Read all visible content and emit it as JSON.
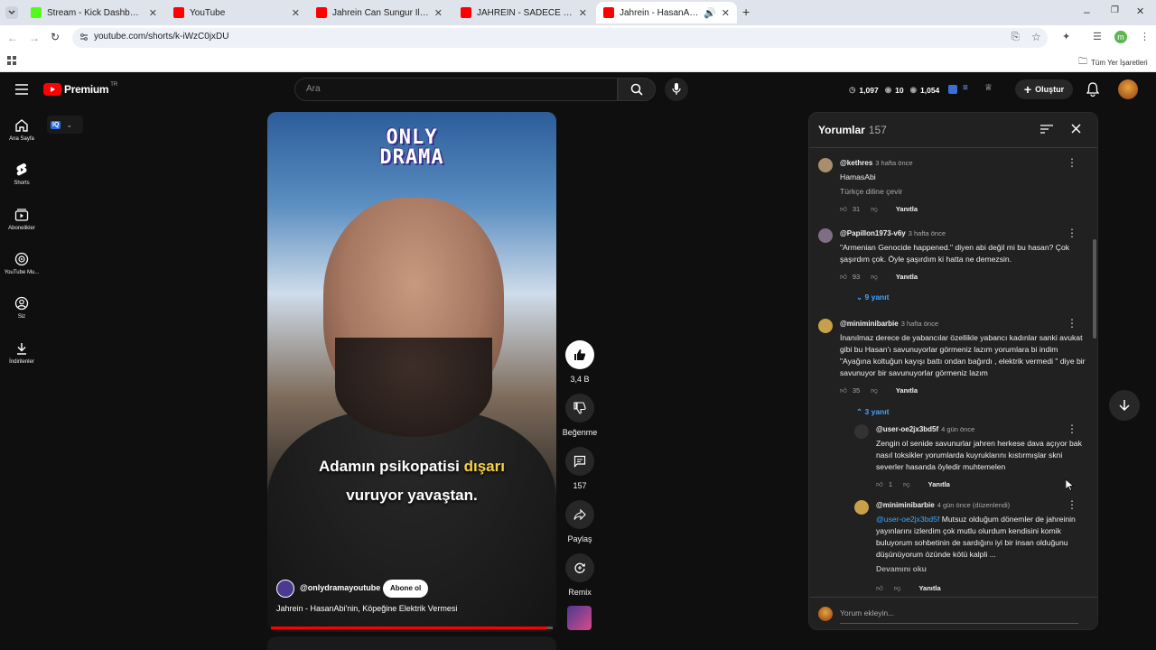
{
  "browser": {
    "tabs": [
      {
        "title": "Stream - Kick Dashboard",
        "color": "#53fc18"
      },
      {
        "title": "YouTube",
        "color": "#ff0000"
      },
      {
        "title": "Jahrein Can Sungur İle Geçmişt",
        "color": "#ff0000"
      },
      {
        "title": "JAHREİN - SADECE ENES \"JAHR",
        "color": "#ff0000"
      },
      {
        "title": "Jahrein - HasanAbi'nin, Köp",
        "color": "#ff0000"
      }
    ],
    "url": "youtube.com/shorts/k-iWzC0jxDU",
    "bookmarks_label": "Tüm Yer İşaretleri",
    "profile_letter": "m"
  },
  "header": {
    "brand": "Premium",
    "brand_sup": "TR",
    "search_placeholder": "Ara",
    "stats": [
      "1,097",
      "10",
      "1,054"
    ],
    "create_label": "Oluştur"
  },
  "sidebar": {
    "items": [
      {
        "label": "Ana Sayfa",
        "icon": "home-icon"
      },
      {
        "label": "Shorts",
        "icon": "shorts-icon"
      },
      {
        "label": "Abonelikler",
        "icon": "subscriptions-icon"
      },
      {
        "label": "YouTube Mu...",
        "icon": "music-icon"
      },
      {
        "label": "Siz",
        "icon": "you-icon"
      },
      {
        "label": "İndirilenler",
        "icon": "download-icon"
      }
    ],
    "extension_badge": "IQ"
  },
  "video": {
    "logo_line1": "ONLY",
    "logo_line2": "DRAMA",
    "caption_line1_a": "Adamın psikopatisi ",
    "caption_line1_b": "dışarı",
    "caption_line2": "vuruyor yavaştan.",
    "channel": "@onlydramayoutube",
    "subscribe": "Abone ol",
    "title": "Jahrein - HasanAbi'nin, Köpeğine Elektrik Vermesi",
    "progress": 0.98
  },
  "actions": {
    "likes": "3,4 B",
    "dislike": "Beğenme",
    "comments": "157",
    "share": "Paylaş",
    "remix": "Remix"
  },
  "comments": {
    "title": "Yorumlar",
    "count": "157",
    "add_placeholder": "Yorum ekleyin...",
    "reply_label": "Yanıtla",
    "list": [
      {
        "handle": "@kethres",
        "time": "3 hafta önce",
        "text": "HamasAbi",
        "translate": "Türkçe diline çevir",
        "likes": "31"
      },
      {
        "handle": "@Papillon1973-v6y",
        "time": "3 hafta önce",
        "text": "\"Armenian Genocide happened.\" diyen abi değil mi bu hasan? Çok şaşırdım çok. Öyle şaşırdım ki hatta ne demezsin.",
        "likes": "93",
        "replies": "9 yanıt"
      },
      {
        "handle": "@miniminibarbie",
        "time": "3 hafta önce",
        "text": "İnanılmaz derece de yabancılar özellikle yabancı kadınlar sanki avukat gibi bu Hasan'ı savunuyorlar görmeniz lazım yorumlara bi indim \"Ayağına koltuğun kayışı battı ondan bağırdı , elektrik vermedi \" diye bir savunuyor bir savunuyorlar görmeniz lazım",
        "likes": "35",
        "replies": "3 yanıt"
      }
    ],
    "replies": [
      {
        "handle": "@user-oe2jx3bd5f",
        "time": "4 gün önce",
        "text": "Zengin ol senide savunurlar jahren herkese dava açıyor bak nasıl toksikler yorumlarda kuyruklarını kıstırmışlar skni severler hasanda öyledir muhtemelen",
        "likes": "1"
      },
      {
        "handle": "@miniminibarbie",
        "time": "4 gün önce (düzenlendi)",
        "mention": "@user-oe2jx3bd5f",
        "text": " Mutsuz olduğum dönemler de jahreinin yayınlarını izlerdim çok mutlu olurdum kendisini komik buluyorum sohbetinin de sardığını iyi bir insan olduğunu düşünüyorum özünde kötü kalpli ...",
        "read_more": "Devamını oku"
      }
    ]
  }
}
